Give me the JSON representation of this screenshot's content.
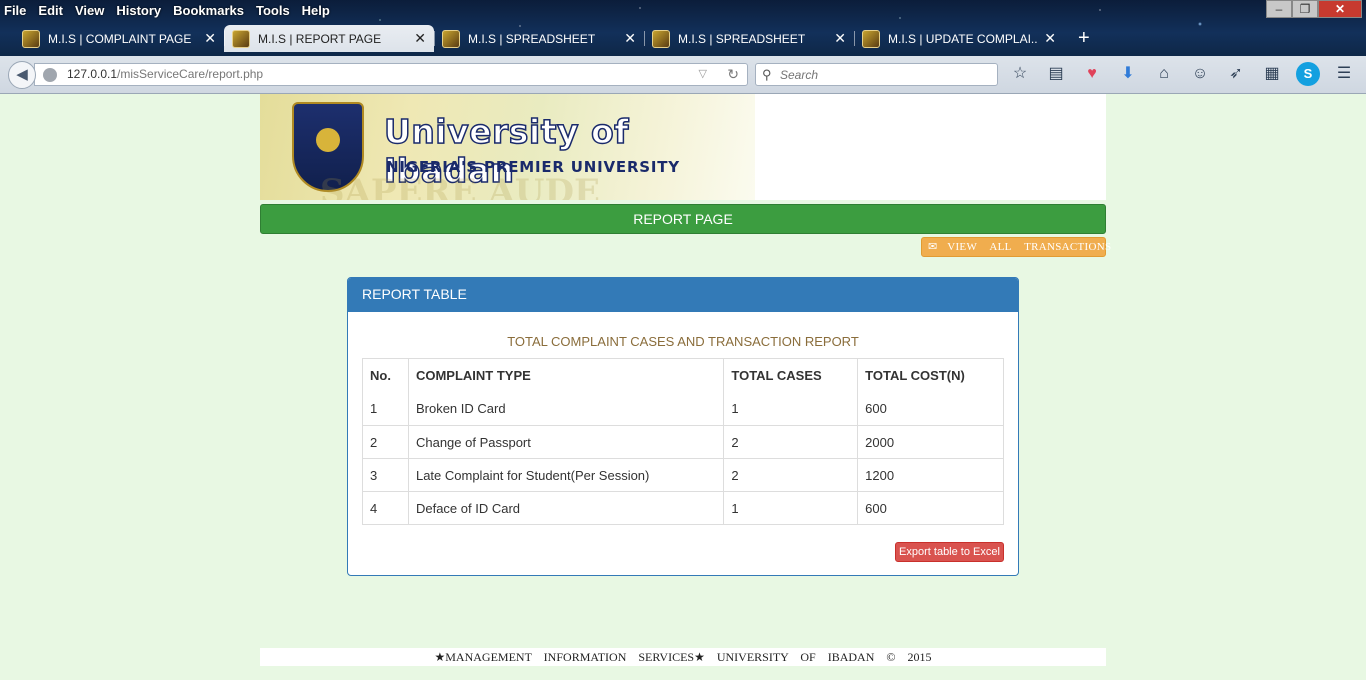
{
  "browser": {
    "menu": [
      "File",
      "Edit",
      "View",
      "History",
      "Bookmarks",
      "Tools",
      "Help"
    ],
    "window_controls": {
      "minimize": "–",
      "restore": "❐",
      "close": "✕"
    },
    "tabs": [
      {
        "title": "M.I.S | COMPLAINT PAGE",
        "active": false
      },
      {
        "title": "M.I.S | REPORT PAGE",
        "active": true
      },
      {
        "title": "M.I.S | SPREADSHEET",
        "active": false
      },
      {
        "title": "M.I.S | SPREADSHEET",
        "active": false
      },
      {
        "title": "M.I.S | UPDATE COMPLAI...",
        "active": false
      }
    ],
    "new_tab": "+",
    "url_host": "127.0.0.1",
    "url_path": "/misServiceCare/report.php",
    "search_placeholder": "Search",
    "toolbar_icons": [
      "bookmark-star-icon",
      "reading-list-icon",
      "pocket-icon",
      "download-icon",
      "home-icon",
      "emoji-icon",
      "send-icon",
      "grid-icon",
      "skype-icon",
      "hamburger-menu-icon"
    ]
  },
  "banner": {
    "name": "University of Ibadan",
    "tagline": "NIGERIA'S PREMIER UNIVERSITY",
    "crest_motto": "SAPERE AUDE"
  },
  "page": {
    "heading": "REPORT PAGE",
    "view_all_label": "VIEW ALL TRANSACTIONS",
    "panel_title": "REPORT TABLE",
    "table_caption": "TOTAL COMPLAINT CASES AND TRANSACTION REPORT",
    "table": {
      "headers": [
        "No.",
        "COMPLAINT TYPE",
        "TOTAL CASES",
        "TOTAL COST(N)"
      ],
      "rows": [
        [
          "1",
          "Broken ID Card",
          "1",
          "600"
        ],
        [
          "2",
          "Change of Passport",
          "2",
          "2000"
        ],
        [
          "3",
          "Late Complaint for Student(Per Session)",
          "2",
          "1200"
        ],
        [
          "4",
          "Deface of ID Card",
          "1",
          "600"
        ]
      ]
    },
    "export_label": "Export table to Excel",
    "footer": "★MANAGEMENT INFORMATION SERVICES★ UNIVERSITY OF IBADAN © 2015"
  },
  "colors": {
    "page_bg": "#e8f8e3",
    "success_green": "#3c9d40",
    "primary_blue": "#337ab7",
    "warning_orange": "#f0ad4e",
    "danger_red": "#d9534f",
    "caption_brown": "#8a6d3b"
  }
}
